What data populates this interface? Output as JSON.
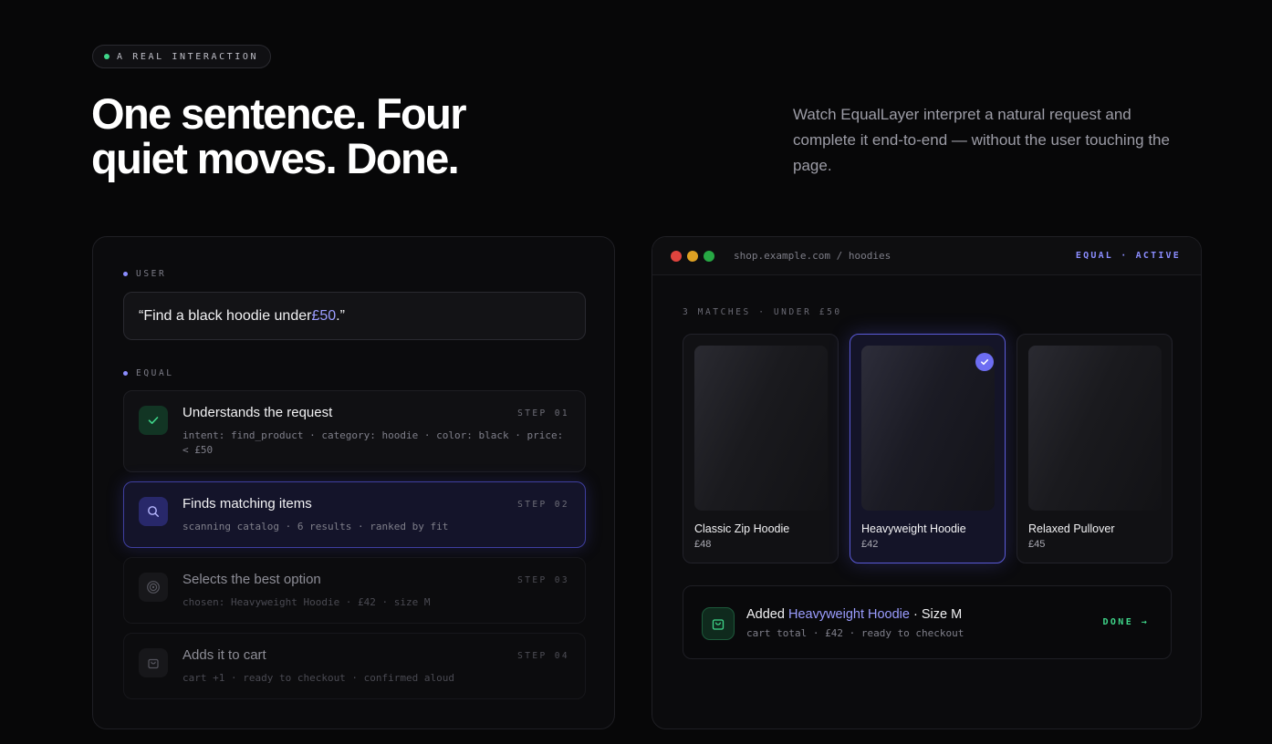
{
  "eyebrow": {
    "text": "A REAL INTERACTION"
  },
  "hero": {
    "title_line1": "One sentence. Four",
    "title_line2": "quiet moves. Done.",
    "description": "Watch EqualLayer interpret a natural request and complete it end-to-end — without the user touching the page."
  },
  "conversation": {
    "user_label": "USER",
    "user_message_prefix": "“Find a black hoodie under ",
    "user_message_accent": "£50",
    "user_message_suffix": ".”",
    "equal_label": "EQUAL",
    "steps": [
      {
        "title": "Understands the request",
        "number": "STEP 01",
        "meta": "intent: find_product · category: hoodie · color: black · price: < £50",
        "icon": "check-icon",
        "state": "done"
      },
      {
        "title": "Finds matching items",
        "number": "STEP 02",
        "meta": "scanning catalog · 6 results · ranked by fit",
        "icon": "search-icon",
        "state": "active"
      },
      {
        "title": "Selects the best option",
        "number": "STEP 03",
        "meta": "chosen: Heavyweight Hoodie · £42 · size M",
        "icon": "target-icon",
        "state": "pending"
      },
      {
        "title": "Adds it to cart",
        "number": "STEP 04",
        "meta": "cart +1 · ready to checkout · confirmed aloud",
        "icon": "bag-icon",
        "state": "pending"
      }
    ]
  },
  "browser": {
    "url": "shop.example.com / hoodies",
    "status": "EQUAL · ACTIVE",
    "matches_label": "3 MATCHES · UNDER £50",
    "products": [
      {
        "name": "Classic Zip Hoodie",
        "price": "£48",
        "selected": false
      },
      {
        "name": "Heavyweight Hoodie",
        "price": "£42",
        "selected": true
      },
      {
        "name": "Relaxed Pullover",
        "price": "£45",
        "selected": false
      }
    ],
    "cart": {
      "prefix": "Added ",
      "product": "Heavyweight Hoodie",
      "suffix": " · Size M",
      "details": "cart total · £42 · ready to checkout",
      "done_label": "DONE →"
    }
  },
  "colors": {
    "accent": "#8b8dff",
    "success": "#3fd68a",
    "traffic_red": "#e0443e",
    "traffic_yellow": "#dea123",
    "traffic_green": "#27a844"
  }
}
